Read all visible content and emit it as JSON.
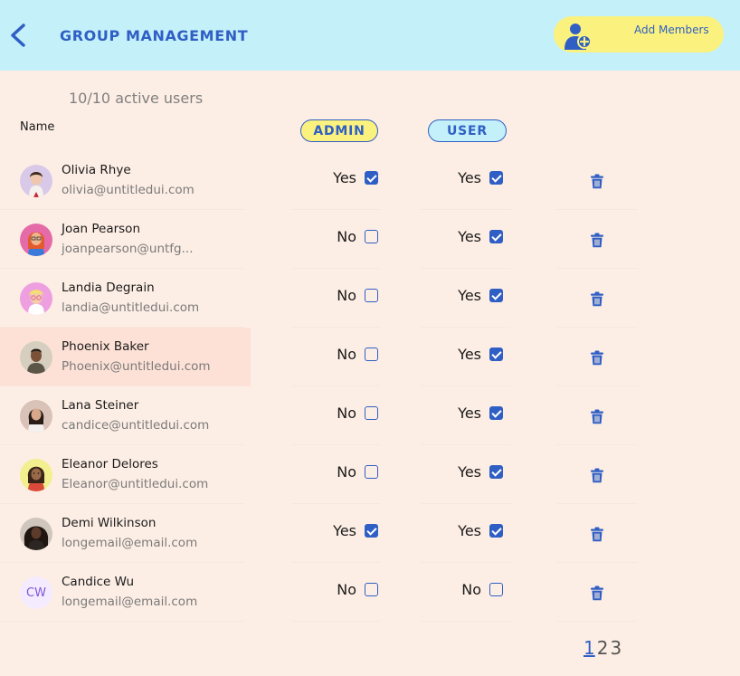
{
  "header": {
    "title": "GROUP MANAGEMENT",
    "add_members_label": "Add Members"
  },
  "summary": {
    "active_users": "10/10 active users"
  },
  "columns": {
    "name": "Name",
    "admin": "ADMIN",
    "user": "USER"
  },
  "users": [
    {
      "name": "Olivia Rhye",
      "email": "olivia@untitledui.com",
      "admin_label": "Yes",
      "admin": true,
      "user_label": "Yes",
      "user": true
    },
    {
      "name": "Joan Pearson",
      "email": "joanpearson@untfg...",
      "admin_label": "No",
      "admin": false,
      "user_label": "Yes",
      "user": true
    },
    {
      "name": "Landia Degrain",
      "email": "landia@untitledui.com",
      "admin_label": "No",
      "admin": false,
      "user_label": "Yes",
      "user": true
    },
    {
      "name": "Phoenix Baker",
      "email": "Phoenix@untitledui.com",
      "admin_label": "No",
      "admin": false,
      "user_label": "Yes",
      "user": true,
      "selected": true
    },
    {
      "name": "Lana Steiner",
      "email": "candice@untitledui.com",
      "admin_label": "No",
      "admin": false,
      "user_label": "Yes",
      "user": true
    },
    {
      "name": "Eleanor Delores",
      "email": "Eleanor@untitledui.com",
      "admin_label": "No",
      "admin": false,
      "user_label": "Yes",
      "user": true
    },
    {
      "name": "Demi Wilkinson",
      "email": "longemail@email.com",
      "admin_label": "Yes",
      "admin": true,
      "user_label": "Yes",
      "user": true
    },
    {
      "name": "Candice Wu",
      "email": "longemail@email.com",
      "admin_label": "No",
      "admin": false,
      "user_label": "No",
      "user": false,
      "initials": "CW"
    }
  ],
  "pagination": {
    "pages": [
      "1",
      "2",
      "3"
    ],
    "current": "1"
  },
  "colors": {
    "accent": "#2f5fc4",
    "header_bg": "#c4f0fa",
    "yellow": "#fbf17e",
    "page_bg": "#fdeee5"
  },
  "icons": {
    "back": "chevron-left-icon",
    "add_member": "user-plus-icon",
    "delete": "trash-icon"
  }
}
